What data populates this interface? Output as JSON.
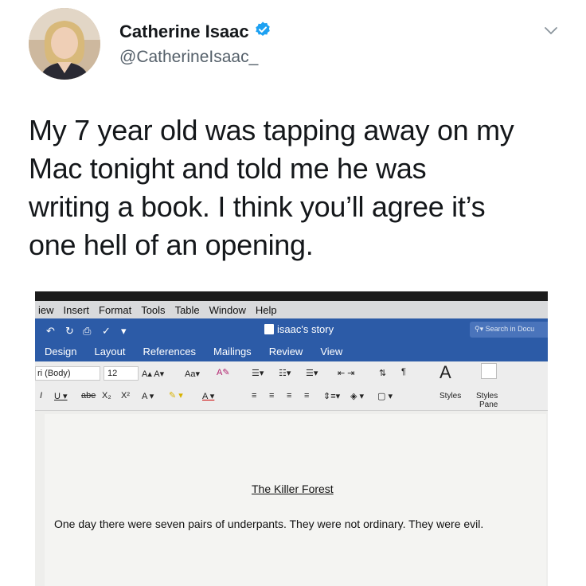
{
  "tweet": {
    "author_name": "Catherine Isaac",
    "handle": "@CatherineIsaac_",
    "text_lines": [
      "My 7 year old was tapping away on my",
      "Mac tonight and told me he was",
      "writing a book. I think you’ll agree it’s",
      "one hell of an opening."
    ],
    "icons": {
      "verified": "verified-badge-icon",
      "menu": "chevron-down-icon"
    },
    "colors": {
      "verified": "#1da1f2",
      "name": "#14171a",
      "handle": "#55606a"
    }
  },
  "word": {
    "menu_items": [
      "iew",
      "Insert",
      "Format",
      "Tools",
      "Table",
      "Window",
      "Help"
    ],
    "doc_title": "isaac's story",
    "search_placeholder": "Search in Docu",
    "tabs": [
      "Design",
      "Layout",
      "References",
      "Mailings",
      "Review",
      "View"
    ],
    "font_name": "ri (Body)",
    "font_size": "12",
    "styles_label": "Styles",
    "styles_pane_label_1": "Styles",
    "styles_pane_label_2": "Pane",
    "colors": {
      "ribbon_blue": "#2c5ba7"
    }
  },
  "document": {
    "heading": "The Killer Forest",
    "body": "One day there were seven pairs of underpants. They were not ordinary. They were evil."
  }
}
